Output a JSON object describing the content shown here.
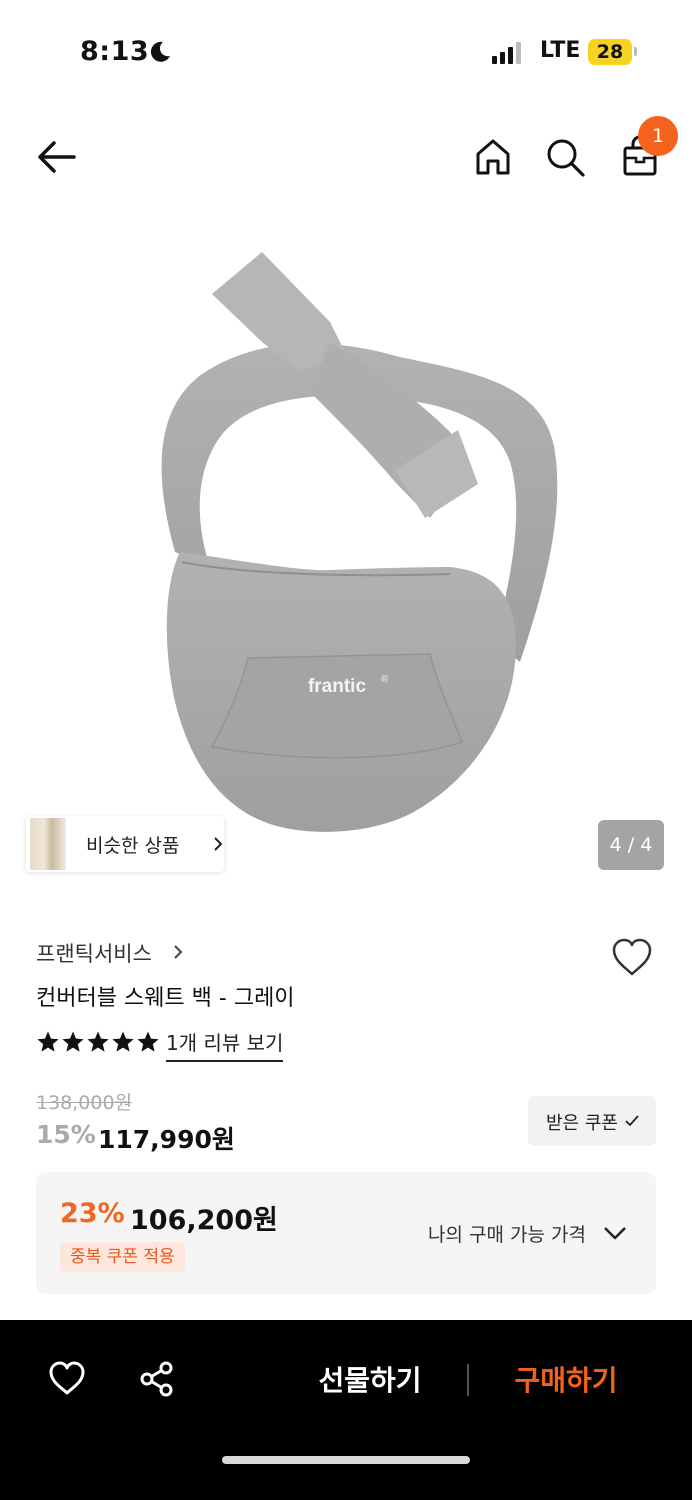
{
  "status_bar": {
    "time": "8:13",
    "network": "LTE",
    "battery": "28"
  },
  "nav": {
    "cart_count": "1"
  },
  "product_image": {
    "logo_text": "frantic",
    "logo_mark": "®"
  },
  "gallery": {
    "similar_label": "비슷한 상품",
    "counter": "4 / 4"
  },
  "product": {
    "brand": "프랜틱서비스",
    "title": "컨버터블 스웨트 백 - 그레이",
    "rating_stars": 5,
    "review_link": "1개 리뷰 보기"
  },
  "price": {
    "original": "138,000원",
    "discount_rate": "15%",
    "discount_price": "117,990원",
    "coupon_button": "받은 쿠폰"
  },
  "best_price": {
    "rate": "23%",
    "price": "106,200원",
    "badge": "중복 쿠폰 적용",
    "label": "나의 구매 가능 가격"
  },
  "bottom_bar": {
    "gift_label": "선물하기",
    "buy_label": "구매하기"
  },
  "colors": {
    "accent": "#f5621c",
    "bag_gray": "#a9a9a9"
  }
}
